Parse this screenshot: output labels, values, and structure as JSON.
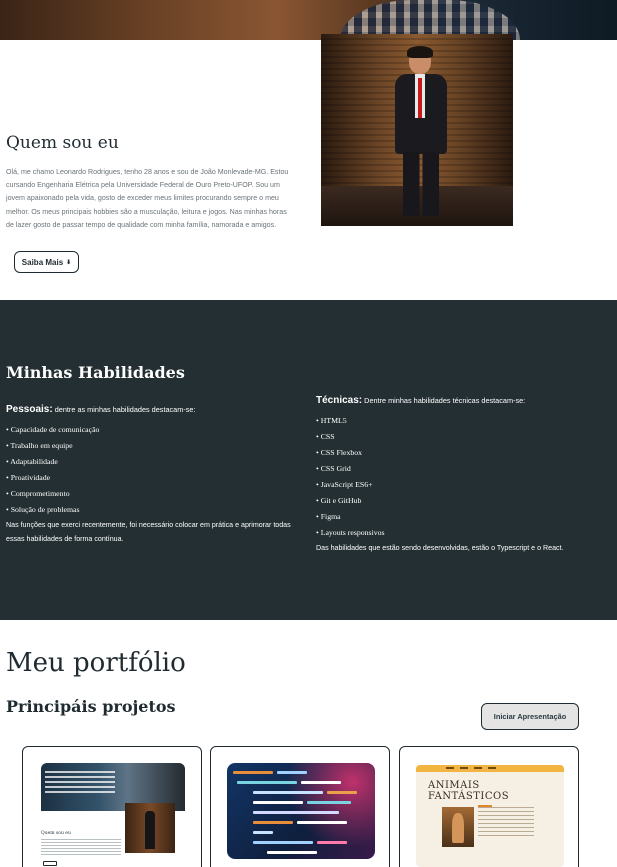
{
  "about": {
    "title": "Quem sou eu",
    "text": "Olá, me chamo Leonardo Rodrigues, tenho 28 anos e sou de João Monlevade-MG. Estou cursando Engenharia Elétrica pela Universidade Federal de Ouro Preto-UFOP. Sou um jovem apaixonado pela vida, gosto de exceder meus limites procurando sempre o meu melhor. Os meus principais hobbies são a musculação, leitura e jogos. Nas minhas horas de lazer gosto de passar tempo de qualidade com minha família, namorada e amigos.",
    "button_label": "Saiba Mais",
    "button_icon": "arrow-down-icon",
    "button_glyph": "⬇"
  },
  "skills": {
    "title": "Minhas Habilidades",
    "personal": {
      "heading": "Pessoais:",
      "intro": " dentre as minhas habilidades destacam-se:",
      "items": [
        "Capacidade de comunicação",
        "Trabalho em equipe",
        "Adaptabilidade",
        "Proatividade",
        "Comprometimento",
        "Solução de problemas"
      ],
      "note": "Nas funções que exerci recentemente, foi necessário colocar em prática e aprimorar todas essas habilidades de forma contínua."
    },
    "technical": {
      "heading": "Técnicas:",
      "intro": " Dentre minhas habilidades técnicas destacam-se:",
      "items": [
        "HTML5",
        "CSS",
        "CSS Flexbox",
        "CSS Grid",
        "JavaScript ES6+",
        "Git e GitHub",
        "Figma",
        "Layouts responsivos"
      ],
      "note": "Das habilidades que estão sendo desenvolvidas, estão o Typescript e o React."
    }
  },
  "portfolio": {
    "title": "Meu portfólio",
    "subtitle": "Principáis projetos",
    "present_button": "Iniciar Apresentação",
    "cards": [
      {
        "thumb_title": "Quem sou eu"
      },
      {
        "thumb_title": ""
      },
      {
        "thumb_title": "ANIMAIS FANTÁSTICOS"
      }
    ]
  },
  "colors": {
    "dark": "#232f33",
    "text": "#1f2b30",
    "muted": "#6a7378",
    "accent_yellow": "#f2b541"
  }
}
